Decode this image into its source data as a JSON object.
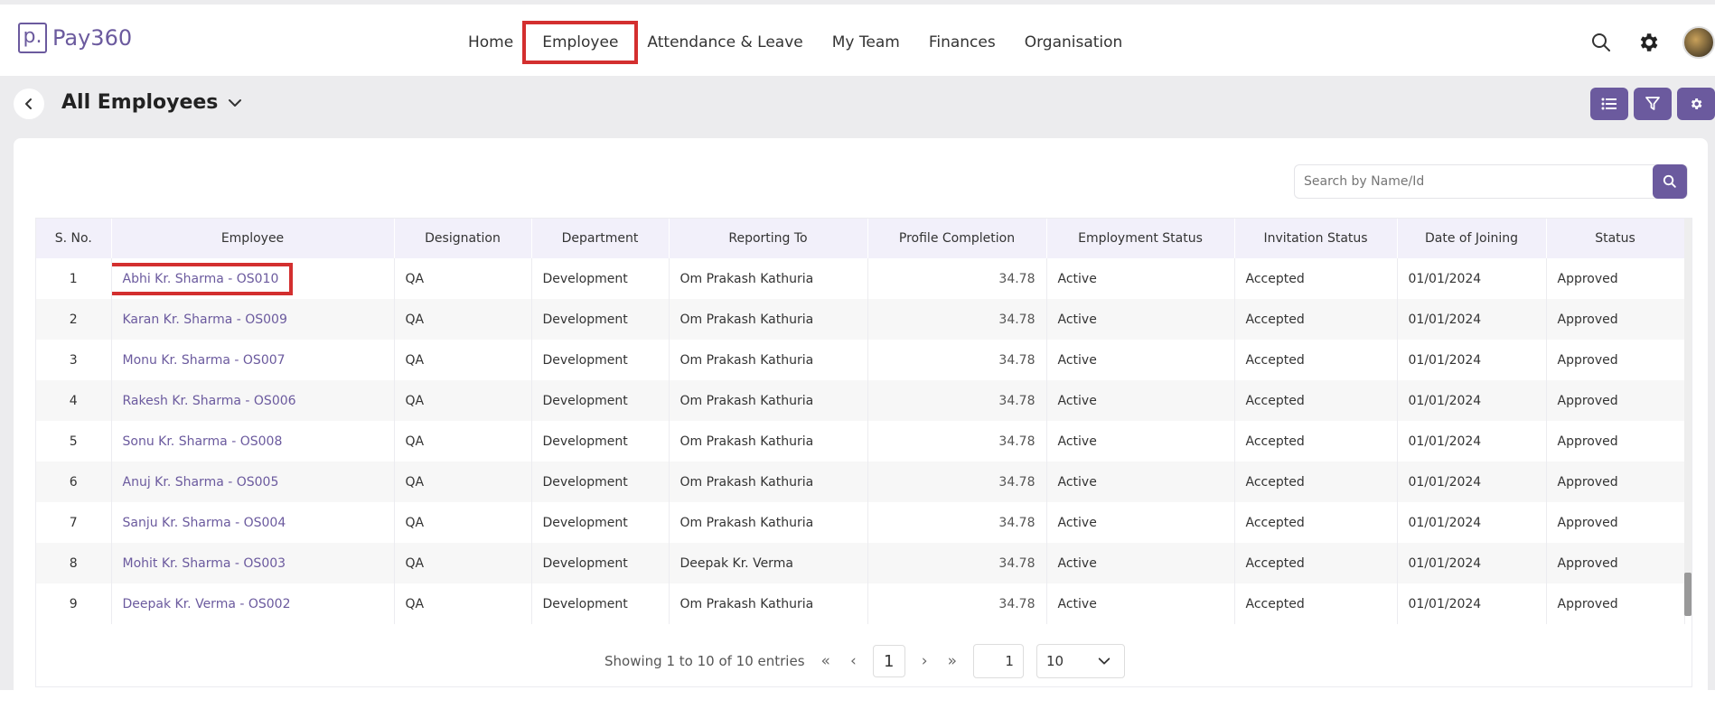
{
  "app": {
    "logo_mark": "p.",
    "logo_text": "Pay360"
  },
  "nav": {
    "items": [
      "Home",
      "Employee",
      "Attendance & Leave",
      "My Team",
      "Finances",
      "Organisation"
    ]
  },
  "header_icons": [
    "search-icon",
    "settings-gear-icon",
    "user-avatar"
  ],
  "page": {
    "title": "All Employees"
  },
  "action_icons": [
    "list-view-icon",
    "filter-icon",
    "settings-icon"
  ],
  "search": {
    "placeholder": "Search by Name/Id",
    "value": ""
  },
  "table": {
    "columns": [
      "S. No.",
      "Employee",
      "Designation",
      "Department",
      "Reporting To",
      "Profile Completion",
      "Employment Status",
      "Invitation Status",
      "Date of Joining",
      "Status"
    ],
    "rows": [
      [
        "1",
        "Abhi Kr. Sharma - OS010",
        "QA",
        "Development",
        "Om Prakash Kathuria",
        "34.78",
        "Active",
        "Accepted",
        "01/01/2024",
        "Approved"
      ],
      [
        "2",
        "Karan Kr. Sharma - OS009",
        "QA",
        "Development",
        "Om Prakash Kathuria",
        "34.78",
        "Active",
        "Accepted",
        "01/01/2024",
        "Approved"
      ],
      [
        "3",
        "Monu Kr. Sharma - OS007",
        "QA",
        "Development",
        "Om Prakash Kathuria",
        "34.78",
        "Active",
        "Accepted",
        "01/01/2024",
        "Approved"
      ],
      [
        "4",
        "Rakesh Kr. Sharma - OS006",
        "QA",
        "Development",
        "Om Prakash Kathuria",
        "34.78",
        "Active",
        "Accepted",
        "01/01/2024",
        "Approved"
      ],
      [
        "5",
        "Sonu Kr. Sharma - OS008",
        "QA",
        "Development",
        "Om Prakash Kathuria",
        "34.78",
        "Active",
        "Accepted",
        "01/01/2024",
        "Approved"
      ],
      [
        "6",
        "Anuj Kr. Sharma - OS005",
        "QA",
        "Development",
        "Om Prakash Kathuria",
        "34.78",
        "Active",
        "Accepted",
        "01/01/2024",
        "Approved"
      ],
      [
        "7",
        "Sanju Kr. Sharma - OS004",
        "QA",
        "Development",
        "Om Prakash Kathuria",
        "34.78",
        "Active",
        "Accepted",
        "01/01/2024",
        "Approved"
      ],
      [
        "8",
        "Mohit Kr. Sharma - OS003",
        "QA",
        "Development",
        "Deepak Kr. Verma",
        "34.78",
        "Active",
        "Accepted",
        "01/01/2024",
        "Approved"
      ],
      [
        "9",
        "Deepak Kr. Verma - OS002",
        "QA",
        "Development",
        "Om Prakash Kathuria",
        "34.78",
        "Active",
        "Accepted",
        "01/01/2024",
        "Approved"
      ]
    ]
  },
  "pagination": {
    "summary": "Showing 1 to 10 of 10 entries",
    "current_page": "1",
    "goto_page": "1",
    "page_size": "10"
  },
  "colors": {
    "brand": "#6b5a9e",
    "highlight": "#d32f2f",
    "header_bg": "#f2f0fa"
  }
}
